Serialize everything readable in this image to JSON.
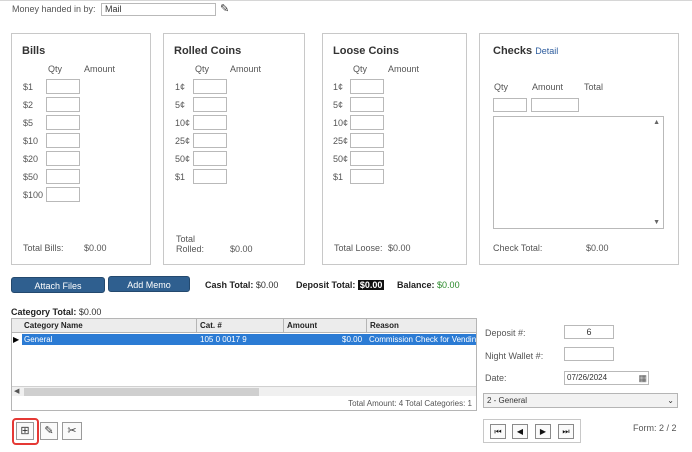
{
  "money_handed_in": {
    "label": "Money handed in by:",
    "value": "Mail"
  },
  "bills": {
    "title": "Bills",
    "qty_header": "Qty",
    "amount_header": "Amount",
    "rows": [
      "$1",
      "$2",
      "$5",
      "$10",
      "$20",
      "$50",
      "$100"
    ],
    "total_label": "Total Bills:",
    "total_value": "$0.00"
  },
  "rolled": {
    "title": "Rolled Coins",
    "qty_header": "Qty",
    "amount_header": "Amount",
    "rows": [
      "1¢",
      "5¢",
      "10¢",
      "25¢",
      "50¢",
      "$1"
    ],
    "total_label_1": "Total",
    "total_label_2": "Rolled:",
    "total_value": "$0.00"
  },
  "loose": {
    "title": "Loose Coins",
    "qty_header": "Qty",
    "amount_header": "Amount",
    "rows": [
      "1¢",
      "5¢",
      "10¢",
      "25¢",
      "50¢",
      "$1"
    ],
    "total_label": "Total Loose:",
    "total_value": "$0.00"
  },
  "checks": {
    "title": "Checks",
    "detail_link": "Detail",
    "qty_header": "Qty",
    "amount_header": "Amount",
    "total_header": "Total",
    "total_label": "Check Total:",
    "total_value": "$0.00"
  },
  "actions": {
    "attach_files": "Attach Files",
    "add_memo": "Add Memo"
  },
  "summary": {
    "cash_label": "Cash Total:",
    "cash_value": "$0.00",
    "deposit_label": "Deposit Total:",
    "deposit_value": "$0.00",
    "balance_label": "Balance:",
    "balance_value": "$0.00"
  },
  "category_total": {
    "label": "Category Total:",
    "value": "$0.00"
  },
  "grid": {
    "headers": [
      "Category Name",
      "Cat. #",
      "Amount",
      "Reason"
    ],
    "row": {
      "name": "General",
      "cat": "105 0 0017 9",
      "amount": "$0.00",
      "reason": "Commission Check for Vending"
    },
    "footer": "Total Amount: 4 Total Categories: 1"
  },
  "deposit": {
    "deposit_no_label": "Deposit #:",
    "deposit_no_value": "6",
    "night_wallet_label": "Night Wallet #:",
    "night_wallet_value": "",
    "date_label": "Date:",
    "date_value": "07/26/2024",
    "category_select": "2 - General"
  },
  "form_counter": "Form: 2 / 2",
  "icons": {
    "add": "add-category-icon",
    "edit": "pencil-icon",
    "delete": "delete-icon",
    "calendar": "calendar-icon"
  },
  "colors": {
    "accent": "#2f5f8f",
    "selection": "#2b7bd4",
    "highlight": "#e53935",
    "balance": "#2a8a2a"
  }
}
